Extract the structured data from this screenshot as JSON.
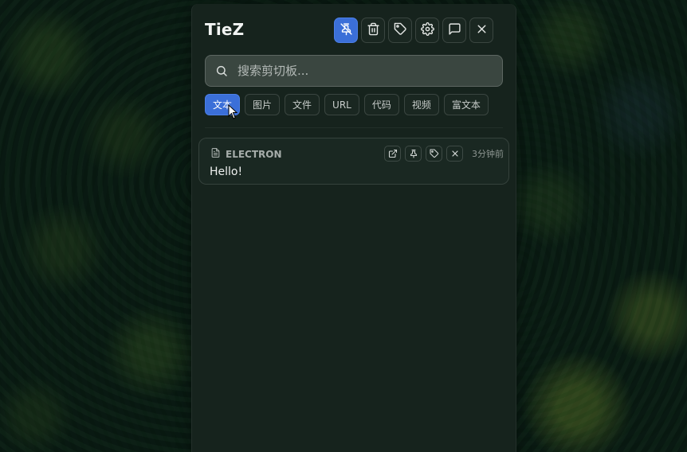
{
  "app": {
    "title": "TieZ"
  },
  "toolbar": {
    "buttons": [
      {
        "icon": "pin-off-icon",
        "active": true
      },
      {
        "icon": "trash-icon",
        "active": false
      },
      {
        "icon": "tag-icon",
        "active": false
      },
      {
        "icon": "gear-icon",
        "active": false
      },
      {
        "icon": "message-icon",
        "active": false
      },
      {
        "icon": "close-icon",
        "active": false
      }
    ]
  },
  "search": {
    "placeholder": "搜索剪切板...",
    "value": ""
  },
  "filters": {
    "items": [
      "文本",
      "图片",
      "文件",
      "URL",
      "代码",
      "视频",
      "富文本"
    ],
    "selected": "文本"
  },
  "clips": [
    {
      "source": "ELECTRON",
      "content": "Hello!",
      "time": "3分钟前",
      "actions": [
        "external-link-icon",
        "pin-icon",
        "tag-icon",
        "close-icon"
      ]
    }
  ],
  "colors": {
    "accent": "#3b6fd8",
    "panel_bg": "#16231d"
  }
}
